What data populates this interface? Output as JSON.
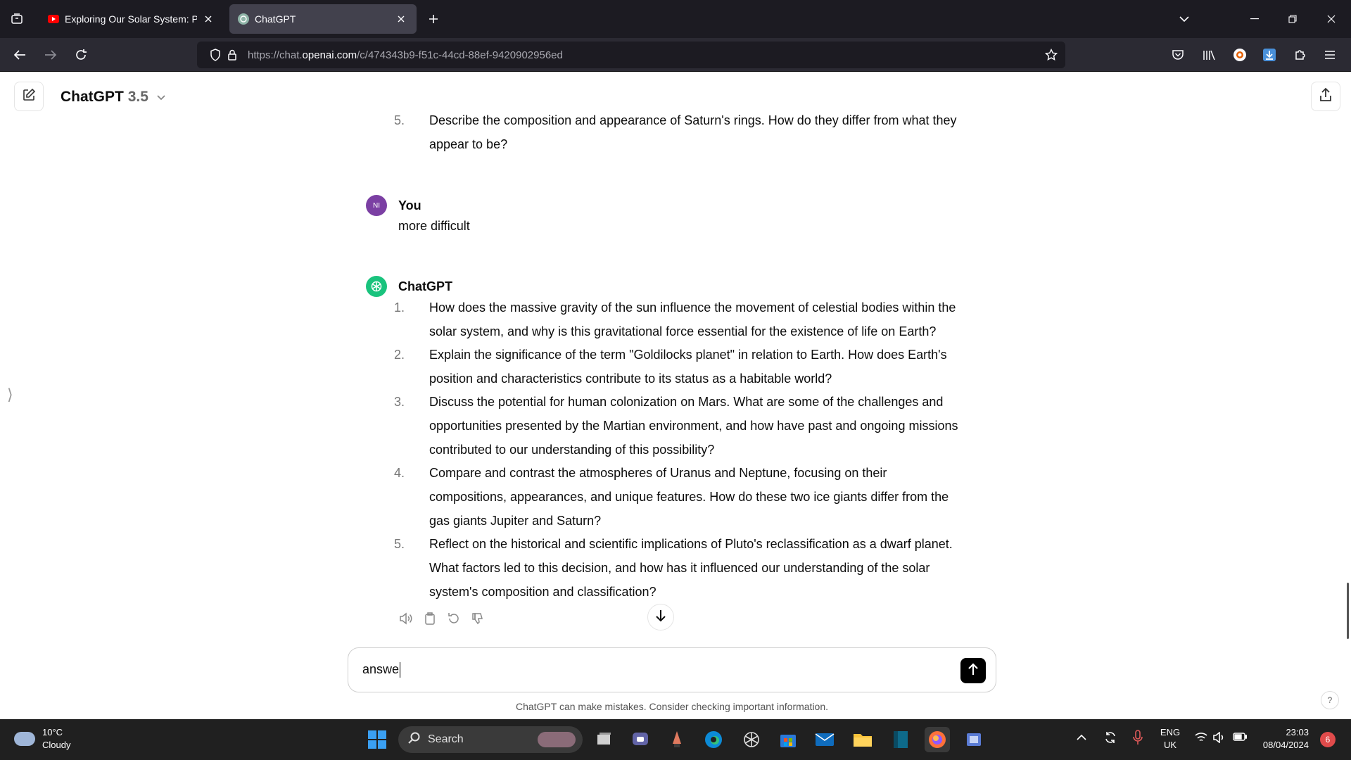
{
  "browser": {
    "tabs": [
      {
        "title": "Exploring Our Solar System: Pla",
        "active": false
      },
      {
        "title": "ChatGPT",
        "active": true
      }
    ],
    "url_prefix": "https://chat.",
    "url_domain": "openai.com",
    "url_path": "/c/474343b9-f51c-44cd-88ef-9420902956ed"
  },
  "app": {
    "model_name": "ChatGPT",
    "model_version": "3.5"
  },
  "conversation": {
    "prev_item": {
      "number": "5.",
      "line1": "Describe the composition and appearance of Saturn's rings. How do they differ from what they",
      "line2": "appear to be?"
    },
    "user_message": {
      "avatar": "NI",
      "author": "You",
      "text": "more difficult"
    },
    "assistant_message": {
      "author": "ChatGPT",
      "items": [
        {
          "number": "1.",
          "lines": [
            "How does the massive gravity of the sun influence the movement of celestial bodies within the",
            "solar system, and why is this gravitational force essential for the existence of life on Earth?"
          ]
        },
        {
          "number": "2.",
          "lines": [
            "Explain the significance of the term \"Goldilocks planet\" in relation to Earth. How does Earth's",
            "position and characteristics contribute to its status as a habitable world?"
          ]
        },
        {
          "number": "3.",
          "lines": [
            "Discuss the potential for human colonization on Mars. What are some of the challenges and",
            "opportunities presented by the Martian environment, and how have past and ongoing missions",
            "contributed to our understanding of this possibility?"
          ]
        },
        {
          "number": "4.",
          "lines": [
            "Compare and contrast the atmospheres of Uranus and Neptune, focusing on their",
            "compositions, appearances, and unique features. How do these two ice giants differ from the",
            "gas giants Jupiter and Saturn?"
          ]
        },
        {
          "number": "5.",
          "lines": [
            "Reflect on the historical and scientific implications of Pluto's reclassification as a dwarf planet.",
            "What factors led to this decision, and how has it influenced our understanding of the solar",
            "system's composition and classification?"
          ]
        }
      ]
    }
  },
  "composer": {
    "value": "answe"
  },
  "disclaimer": "ChatGPT can make mistakes. Consider checking important information.",
  "help_label": "?",
  "taskbar": {
    "weather_temp": "10°C",
    "weather_desc": "Cloudy",
    "search_label": "Search",
    "lang_line1": "ENG",
    "lang_line2": "UK",
    "time": "23:03",
    "date": "08/04/2024",
    "notification_count": "6"
  },
  "colors": {
    "chrome_dark": "#1c1b22",
    "toolbar": "#2b2a33",
    "gpt_green": "#19c37d",
    "user_avatar": "#7b3fa3",
    "taskbar": "#202020"
  }
}
